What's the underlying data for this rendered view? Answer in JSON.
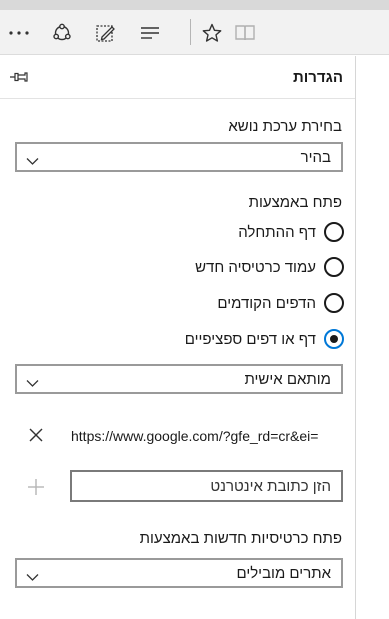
{
  "toolbar": {
    "more_icon": "more-dots-icon",
    "share_icon": "share-icon",
    "notes_icon": "web-note-icon",
    "hub_icon": "hub-lines-icon",
    "favorite_icon": "star-icon",
    "reading_icon": "reading-view-icon"
  },
  "settings": {
    "title": "הגדרות",
    "pin_icon": "pin-icon",
    "theme": {
      "label": "בחירת ערכת נושא",
      "value": "בהיר"
    },
    "open_with": {
      "label": "פתח באמצעות",
      "options": [
        {
          "label": "דף ההתחלה",
          "checked": false
        },
        {
          "label": "עמוד כרטיסיה חדש",
          "checked": false
        },
        {
          "label": "הדפים הקודמים",
          "checked": false
        },
        {
          "label": "דף או דפים ספציפיים",
          "checked": true
        }
      ],
      "pages_select": "מותאם אישית",
      "url": "https://www.google.com/?gfe_rd=cr&ei=",
      "url_placeholder": "הזן כתובת אינטרנט"
    },
    "new_tabs": {
      "label": "פתח כרטיסיות חדשות באמצעות",
      "value": "אתרים מובילים"
    }
  },
  "colors": {
    "accent": "#0078d7",
    "toolbar_bg": "#f2f2f2"
  }
}
